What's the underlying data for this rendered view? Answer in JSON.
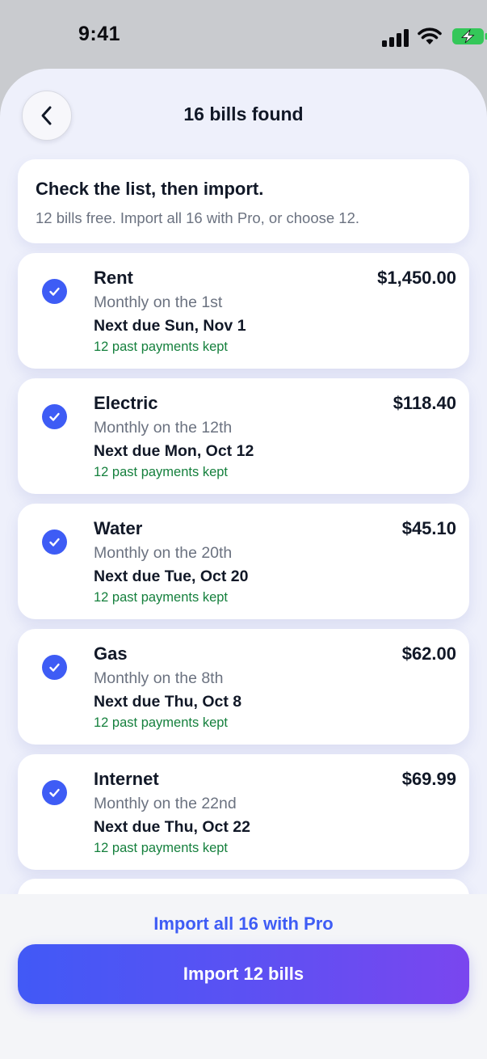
{
  "status_bar": {
    "time": "9:41",
    "icons": [
      "signal-icon",
      "wifi-icon",
      "battery-charging-icon"
    ],
    "battery_color": "#34c759"
  },
  "header": {
    "title": "16 bills found",
    "back_icon": "chevron-left-icon"
  },
  "info": {
    "title": "Check the list, then import.",
    "subtitle": "12 bills free. Import all 16 with Pro, or choose 12."
  },
  "bills": [
    {
      "name": "Rent",
      "amount": "$1,450.00",
      "frequency": "Monthly on the 1st",
      "next_due": "Next due Sun, Nov 1",
      "history": "12 past payments kept",
      "checked": true
    },
    {
      "name": "Electric",
      "amount": "$118.40",
      "frequency": "Monthly on the 12th",
      "next_due": "Next due Mon, Oct 12",
      "history": "12 past payments kept",
      "checked": true
    },
    {
      "name": "Water",
      "amount": "$45.10",
      "frequency": "Monthly on the 20th",
      "next_due": "Next due Tue, Oct 20",
      "history": "12 past payments kept",
      "checked": true
    },
    {
      "name": "Gas",
      "amount": "$62.00",
      "frequency": "Monthly on the 8th",
      "next_due": "Next due Thu, Oct 8",
      "history": "12 past payments kept",
      "checked": true
    },
    {
      "name": "Internet",
      "amount": "$69.99",
      "frequency": "Monthly on the 22nd",
      "next_due": "Next due Thu, Oct 22",
      "history": "12 past payments kept",
      "checked": true
    }
  ],
  "footer": {
    "pro_link": "Import all 16 with Pro",
    "import_button": "Import 12 bills"
  },
  "colors": {
    "accent": "#3e5cf5",
    "gradient_end": "#7a46ef",
    "history_green": "#15803d"
  }
}
